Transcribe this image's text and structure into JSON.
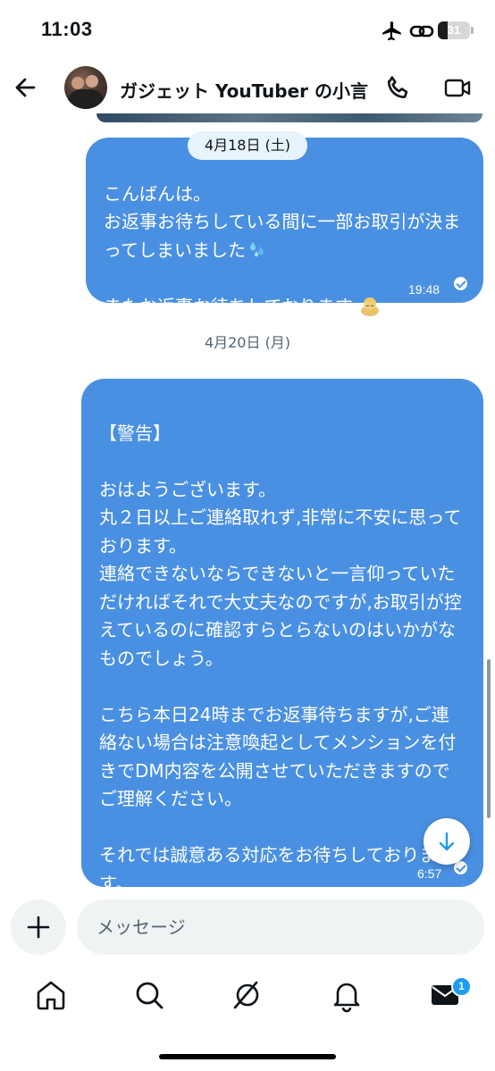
{
  "status_bar": {
    "time": "11:03",
    "battery": "31",
    "battery_level_percent": 31
  },
  "header": {
    "title": "ガジェット YouTuber の小言"
  },
  "messages": [
    {
      "date": "4月18日 (土)",
      "text": "こんばんは。\nお返事お待ちしている間に一部お取引が決まってしまいました",
      "text2": "またお返事お待ちしております",
      "time": "19:48"
    },
    {
      "date": "4月20日 (月)",
      "text": "【警告】\n\nおはようございます。\n丸２日以上ご連絡取れず,非常に不安に思っております。\n連絡できないならできないと一言仰っていただければそれで大丈夫なのですが,お取引が控えているのに確認すらとらないのはいかがなものでしょう。\n\nこちら本日24時までお返事待ちますが,ご連絡ない場合は注意喚起としてメンションを付きでDM内容を公開させていただきますのでご理解ください。\n\nそれでは誠意ある対応をお待ちしております。",
      "time": "6:57"
    }
  ],
  "composer": {
    "placeholder": "メッセージ"
  },
  "tabbar": {
    "messages_badge": "1"
  },
  "colors": {
    "bubble": "#4a90e2",
    "accent": "#1d9bf0",
    "date_pill": "#e8f4fd"
  },
  "icons": [
    "airplane-icon",
    "link-icon",
    "back-arrow-icon",
    "phone-icon",
    "video-icon",
    "plus-icon",
    "home-icon",
    "search-icon",
    "grok-icon",
    "bell-icon",
    "mail-icon",
    "arrow-down-icon",
    "check-icon",
    "droplets-emoji",
    "bowing-person-emoji"
  ]
}
